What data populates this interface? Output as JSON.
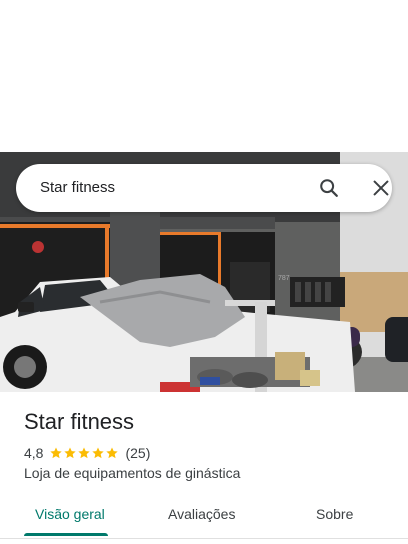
{
  "search": {
    "query": "Star fitness"
  },
  "place": {
    "name": "Star fitness",
    "rating": "4,8",
    "stars": 5,
    "review_count": "(25)",
    "category": "Loja de equipamentos de ginástica"
  },
  "tabs": [
    {
      "label": "Visão geral",
      "active": true
    },
    {
      "label": "Avaliações",
      "active": false
    },
    {
      "label": "Sobre",
      "active": false
    }
  ],
  "colors": {
    "accent": "#00796b",
    "star": "#fbbc04",
    "text_primary": "#202124",
    "text_secondary": "#3c4043"
  }
}
